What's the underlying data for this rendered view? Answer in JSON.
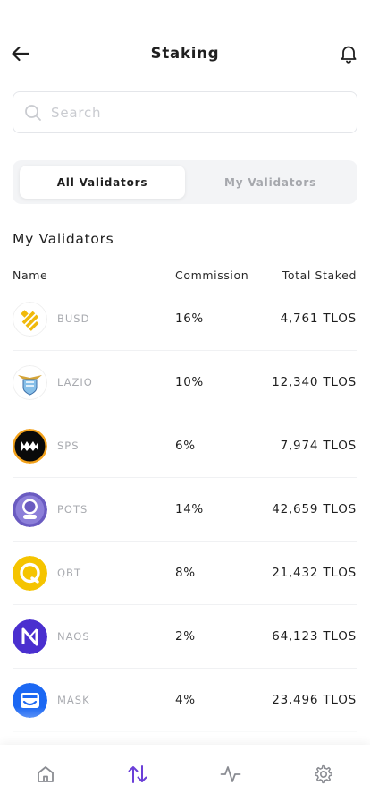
{
  "header": {
    "title": "Staking",
    "back_icon": "arrow-left-icon",
    "bell_icon": "bell-icon"
  },
  "search": {
    "placeholder": "Search",
    "value": ""
  },
  "tabs": [
    {
      "label": "All Validators",
      "active": true
    },
    {
      "label": "My Validators",
      "active": false
    }
  ],
  "section": {
    "title": "My Validators"
  },
  "table": {
    "columns": [
      "Name",
      "Commission",
      "Total Staked"
    ],
    "rows": [
      {
        "symbol": "BUSD",
        "commission": "16%",
        "total": "4,761 TLOS",
        "icon": "busd-logo-icon",
        "color": "#F0B90B"
      },
      {
        "symbol": "LAZIO",
        "commission": "10%",
        "total": "12,340 TLOS",
        "icon": "lazio-logo-icon",
        "color": "#87BFE8"
      },
      {
        "symbol": "SPS",
        "commission": "6%",
        "total": "7,974 TLOS",
        "icon": "sps-logo-icon",
        "color": "#000000"
      },
      {
        "symbol": "POTS",
        "commission": "14%",
        "total": "42,659 TLOS",
        "icon": "pots-logo-icon",
        "color": "#6A5BC1"
      },
      {
        "symbol": "QBT",
        "commission": "8%",
        "total": "21,432 TLOS",
        "icon": "qbt-logo-icon",
        "color": "#F5C400"
      },
      {
        "symbol": "NAOS",
        "commission": "2%",
        "total": "64,123 TLOS",
        "icon": "naos-logo-icon",
        "color": "#4A2FCF"
      },
      {
        "symbol": "MASK",
        "commission": "4%",
        "total": "23,496 TLOS",
        "icon": "mask-logo-icon",
        "color": "#1C68F3"
      }
    ]
  },
  "bottom_nav": [
    {
      "icon": "home-icon",
      "active": false
    },
    {
      "icon": "transfer-arrows-icon",
      "active": true
    },
    {
      "icon": "activity-icon",
      "active": false
    },
    {
      "icon": "settings-gear-icon",
      "active": false
    }
  ],
  "colors": {
    "accent": "#6B3FD8",
    "text": "#1F1F1F",
    "muted": "#A9ABB0"
  }
}
